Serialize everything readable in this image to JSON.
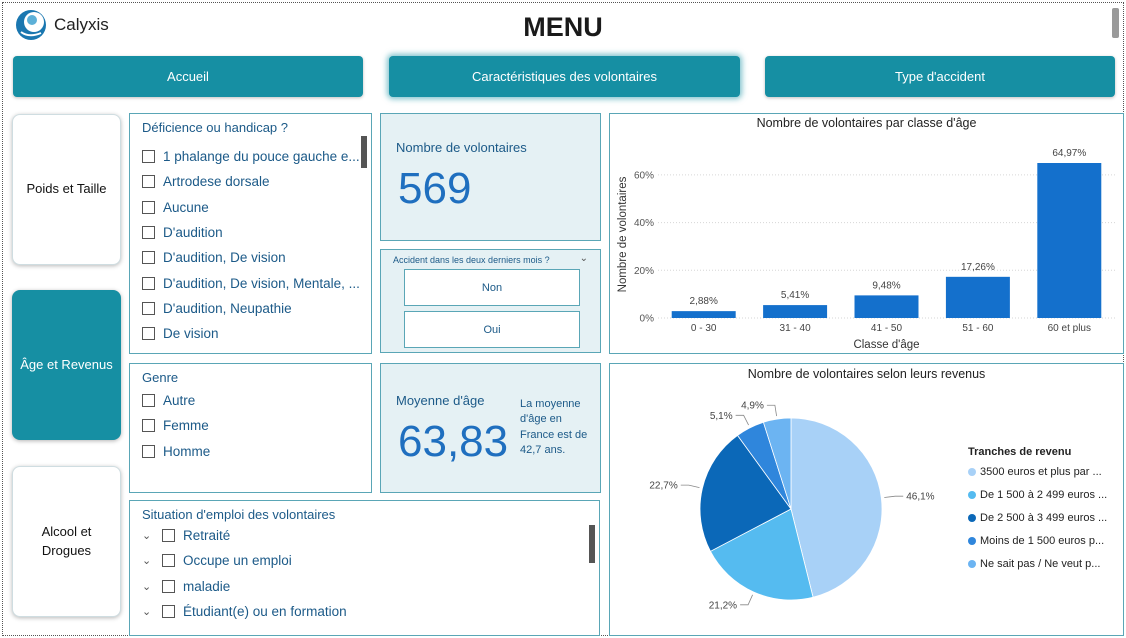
{
  "header": {
    "logo_text": "Calyxis",
    "title": "MENU"
  },
  "nav": [
    {
      "label": "Accueil"
    },
    {
      "label": "Caractéristiques des volontaires"
    },
    {
      "label": "Type d'accident"
    }
  ],
  "side_nav": [
    {
      "label": "Poids et Taille"
    },
    {
      "label": "Âge et Revenus"
    },
    {
      "label": "Alcool et Drogues"
    }
  ],
  "deficience": {
    "title": "Déficience ou handicap ?",
    "items": [
      "1 phalange du pouce gauche e...",
      "Artrodese dorsale",
      "Aucune",
      "D'audition",
      "D'audition, De vision",
      "D'audition, De vision, Mentale, ...",
      "D'audition, Neupathie",
      "De vision"
    ]
  },
  "genre": {
    "title": "Genre",
    "items": [
      "Autre",
      "Femme",
      "Homme"
    ]
  },
  "emploi": {
    "title": "Situation d'emploi des volontaires",
    "items": [
      "Retraité",
      "Occupe un emploi",
      "maladie",
      "Étudiant(e) ou en formation"
    ]
  },
  "kpi_volontaires": {
    "label": "Nombre de volontaires",
    "value": "569"
  },
  "accident": {
    "title": "Accident dans les deux derniers mois ?",
    "options": [
      "Non",
      "Oui"
    ]
  },
  "kpi_age": {
    "label": "Moyenne d'âge",
    "value": "63,83",
    "note": "La moyenne d'âge en France est de 42,7 ans."
  },
  "colors": {
    "accent": "#168fa3",
    "bar": "#1470cc",
    "text_blue": "#1c5a88"
  },
  "chart_data": [
    {
      "type": "bar",
      "title": "Nombre de volontaires par classe d'âge",
      "xlabel": "Classe d'âge",
      "ylabel": "Nombre de volontaires",
      "categories": [
        "0 - 30",
        "31 - 40",
        "41 - 50",
        "51 - 60",
        "60 et plus"
      ],
      "values": [
        2.88,
        5.41,
        9.48,
        17.26,
        64.97
      ],
      "data_labels": [
        "2,88%",
        "5,41%",
        "9,48%",
        "17,26%",
        "64,97%"
      ],
      "ylim": [
        0,
        70
      ],
      "yticks": [
        0,
        20,
        40,
        60
      ],
      "ytick_labels": [
        "0%",
        "20%",
        "40%",
        "60%"
      ],
      "grid": true
    },
    {
      "type": "pie",
      "title": "Nombre de volontaires selon leurs revenus",
      "legend_title": "Tranches de revenu",
      "legend_position": "right",
      "labels": [
        "3500 euros et plus par ...",
        "De 1 500 à 2 499 euros ...",
        "De 2 500 à 3 499 euros ...",
        "Moins de 1 500 euros p...",
        "Ne sait pas / Ne veut p..."
      ],
      "values": [
        46.1,
        21.2,
        22.7,
        5.1,
        4.9
      ],
      "data_labels": [
        "46,1%",
        "21,2%",
        "22,7%",
        "5,1%",
        "4,9%"
      ],
      "colors": [
        "#a8d1f7",
        "#55bbf0",
        "#0b68b8",
        "#2f86dc",
        "#6cb4f2"
      ]
    }
  ]
}
